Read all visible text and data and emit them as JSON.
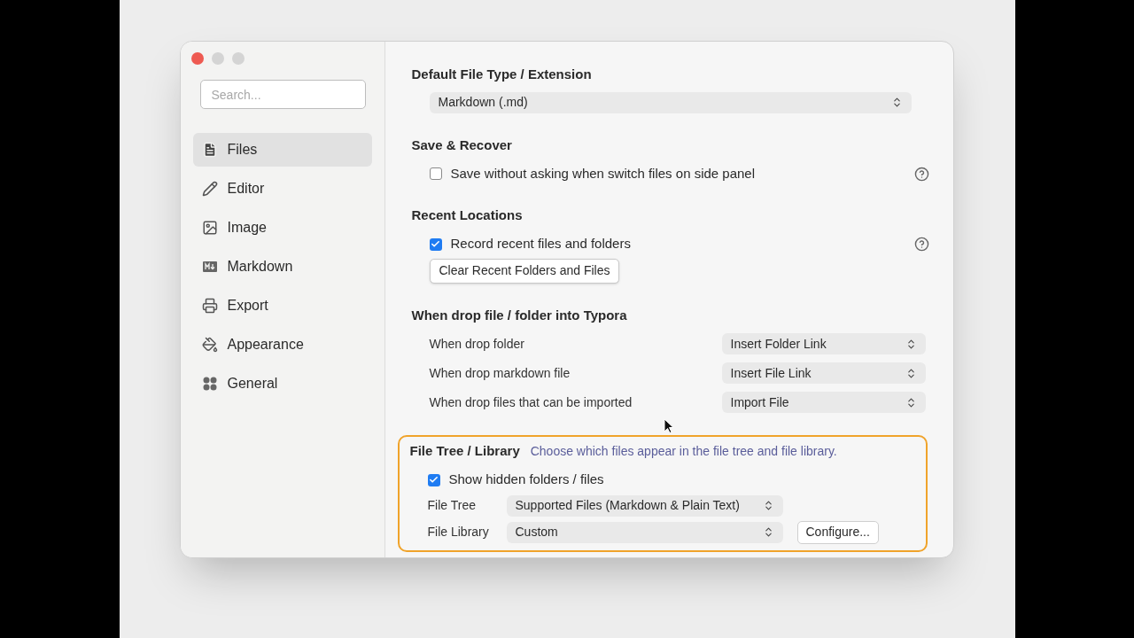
{
  "sidebar": {
    "search": {
      "placeholder": "Search..."
    },
    "items": [
      {
        "label": "Files",
        "selected": true
      },
      {
        "label": "Editor",
        "selected": false
      },
      {
        "label": "Image",
        "selected": false
      },
      {
        "label": "Markdown",
        "selected": false
      },
      {
        "label": "Export",
        "selected": false
      },
      {
        "label": "Appearance",
        "selected": false
      },
      {
        "label": "General",
        "selected": false
      }
    ]
  },
  "sections": [
    {
      "heading": "Default File Type / Extension",
      "highlighted": false,
      "rows": [
        {
          "kind": "select",
          "value": "Markdown (.md)"
        }
      ]
    },
    {
      "heading": "Save & Recover",
      "highlighted": false,
      "rows": [
        {
          "kind": "checkbox",
          "label": "Save without asking when switch files on side panel",
          "checked": false,
          "help": true
        }
      ]
    },
    {
      "heading": "Recent Locations",
      "highlighted": false,
      "rows": [
        {
          "kind": "checkbox",
          "label": "Record recent files and folders",
          "checked": true,
          "help": true
        },
        {
          "kind": "button",
          "label": "Clear Recent Folders and Files"
        }
      ]
    },
    {
      "heading": "When drop file / folder into Typora",
      "highlighted": false,
      "rows": [
        {
          "kind": "option",
          "label": "When drop folder",
          "value": "Insert Folder Link"
        },
        {
          "kind": "option",
          "label": "When drop markdown file",
          "value": "Insert File Link"
        },
        {
          "kind": "option",
          "label": "When drop files that can be imported",
          "value": "Import File"
        }
      ]
    },
    {
      "heading": "File Tree / Library",
      "description": "Choose which files appear in the file tree and file library.",
      "highlighted": true,
      "rows": [
        {
          "kind": "checkbox",
          "label": "Show hidden folders / files",
          "checked": true,
          "help": false
        },
        {
          "kind": "compact",
          "label": "File Tree",
          "value": "Supported Files (Markdown & Plain Text)"
        },
        {
          "kind": "compact",
          "label": "File Library",
          "value": "Custom",
          "button": "Configure..."
        }
      ]
    }
  ]
}
